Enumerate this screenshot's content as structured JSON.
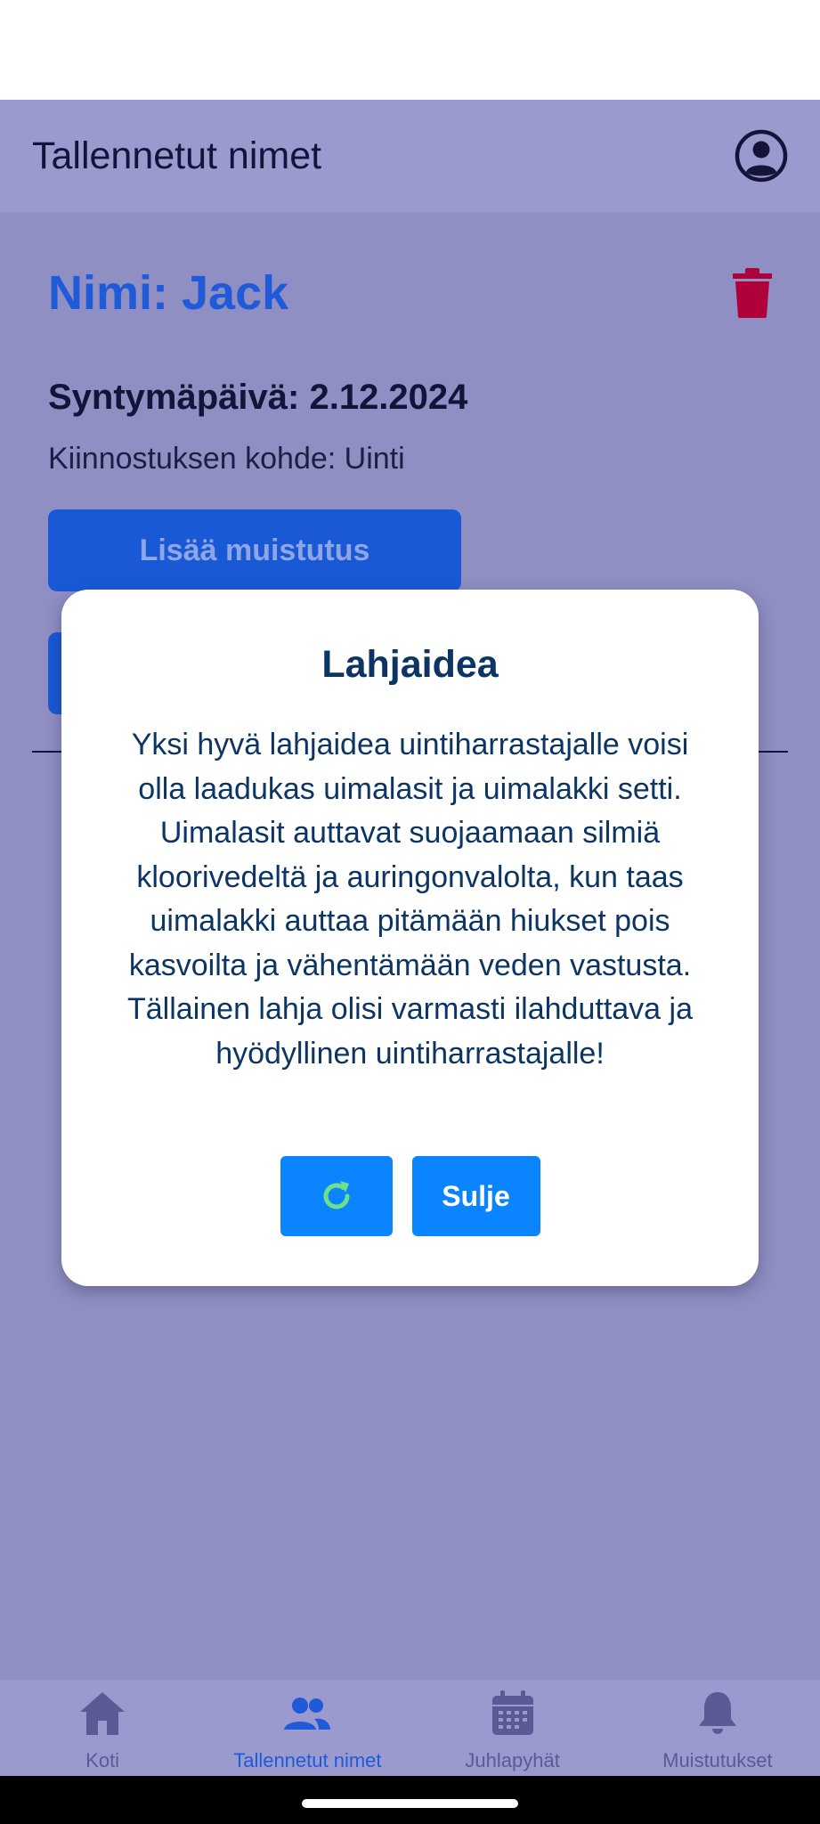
{
  "header": {
    "title": "Tallennetut nimet",
    "account_icon": "account-circle-icon"
  },
  "person": {
    "name_label": "Nimi: Jack",
    "birthday_label": "Syntymäpäivä: 2.12.2024",
    "interest_label": "Kiinnostuksen kohde: Uinti",
    "add_reminder_label": "Lisää muistutus",
    "delete_icon": "trash-icon"
  },
  "dialog": {
    "title": "Lahjaidea",
    "body": "Yksi hyvä lahjaidea uintiharrastajalle voisi olla laadukas uimalasit ja uimalakki setti. Uimalasit auttavat suojaamaan silmiä kloorivedeltä ja auringonvalolta, kun taas uimalakki auttaa pitämään hiukset pois kasvoilta ja vähentämään veden vastusta. Tällainen lahja olisi varmasti ilahduttava ja hyödyllinen uintiharrastajalle!",
    "refresh_icon": "refresh-icon",
    "close_label": "Sulje"
  },
  "nav": {
    "items": [
      {
        "label": "Koti",
        "icon": "home-icon",
        "active": false
      },
      {
        "label": "Tallennetut nimet",
        "icon": "people-icon",
        "active": true
      },
      {
        "label": "Juhlapyhät",
        "icon": "calendar-icon",
        "active": false
      },
      {
        "label": "Muistutukset",
        "icon": "bell-icon",
        "active": false
      }
    ]
  },
  "colors": {
    "header_bg": "#9a9ace",
    "content_bg": "#8f8fc3",
    "accent_blue": "#1f5ad8",
    "dialog_button": "#0a84ff",
    "delete_red": "#b0003a",
    "refresh_green": "#6ee08a"
  }
}
